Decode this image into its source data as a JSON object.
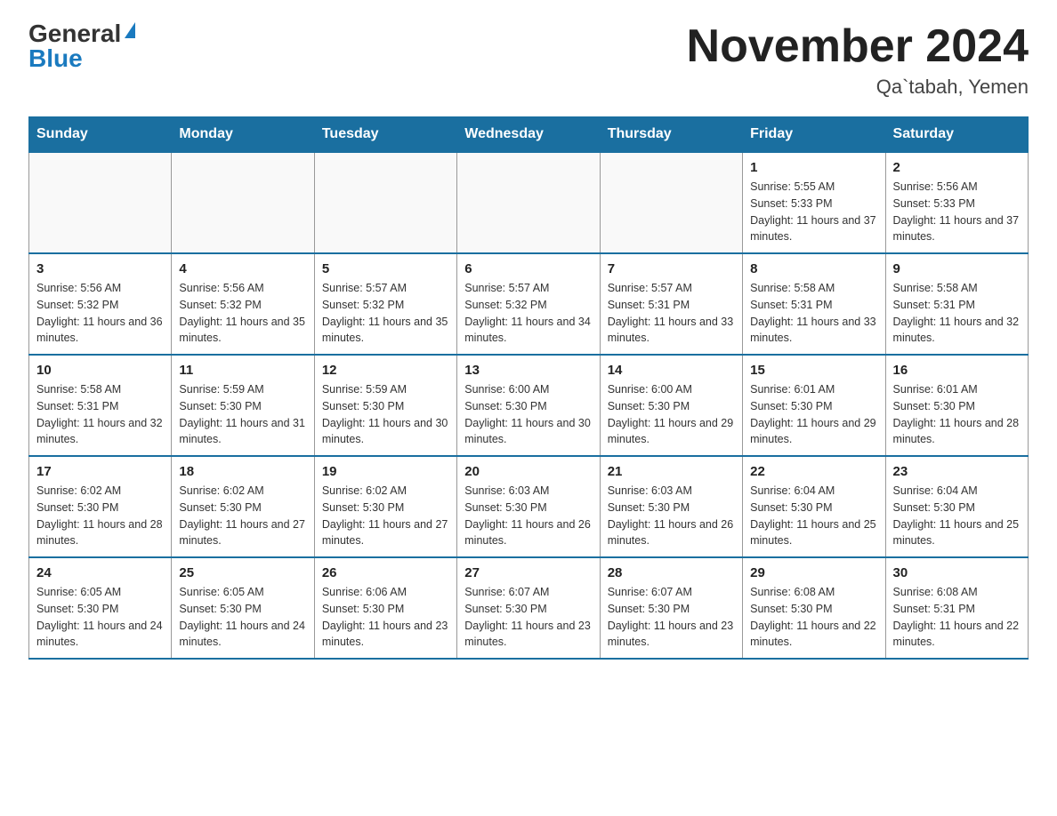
{
  "header": {
    "logo_general": "General",
    "logo_blue": "Blue",
    "title": "November 2024",
    "subtitle": "Qa`tabah, Yemen"
  },
  "calendar": {
    "days_of_week": [
      "Sunday",
      "Monday",
      "Tuesday",
      "Wednesday",
      "Thursday",
      "Friday",
      "Saturday"
    ],
    "weeks": [
      [
        {
          "day": "",
          "info": ""
        },
        {
          "day": "",
          "info": ""
        },
        {
          "day": "",
          "info": ""
        },
        {
          "day": "",
          "info": ""
        },
        {
          "day": "",
          "info": ""
        },
        {
          "day": "1",
          "info": "Sunrise: 5:55 AM\nSunset: 5:33 PM\nDaylight: 11 hours and 37 minutes."
        },
        {
          "day": "2",
          "info": "Sunrise: 5:56 AM\nSunset: 5:33 PM\nDaylight: 11 hours and 37 minutes."
        }
      ],
      [
        {
          "day": "3",
          "info": "Sunrise: 5:56 AM\nSunset: 5:32 PM\nDaylight: 11 hours and 36 minutes."
        },
        {
          "day": "4",
          "info": "Sunrise: 5:56 AM\nSunset: 5:32 PM\nDaylight: 11 hours and 35 minutes."
        },
        {
          "day": "5",
          "info": "Sunrise: 5:57 AM\nSunset: 5:32 PM\nDaylight: 11 hours and 35 minutes."
        },
        {
          "day": "6",
          "info": "Sunrise: 5:57 AM\nSunset: 5:32 PM\nDaylight: 11 hours and 34 minutes."
        },
        {
          "day": "7",
          "info": "Sunrise: 5:57 AM\nSunset: 5:31 PM\nDaylight: 11 hours and 33 minutes."
        },
        {
          "day": "8",
          "info": "Sunrise: 5:58 AM\nSunset: 5:31 PM\nDaylight: 11 hours and 33 minutes."
        },
        {
          "day": "9",
          "info": "Sunrise: 5:58 AM\nSunset: 5:31 PM\nDaylight: 11 hours and 32 minutes."
        }
      ],
      [
        {
          "day": "10",
          "info": "Sunrise: 5:58 AM\nSunset: 5:31 PM\nDaylight: 11 hours and 32 minutes."
        },
        {
          "day": "11",
          "info": "Sunrise: 5:59 AM\nSunset: 5:30 PM\nDaylight: 11 hours and 31 minutes."
        },
        {
          "day": "12",
          "info": "Sunrise: 5:59 AM\nSunset: 5:30 PM\nDaylight: 11 hours and 30 minutes."
        },
        {
          "day": "13",
          "info": "Sunrise: 6:00 AM\nSunset: 5:30 PM\nDaylight: 11 hours and 30 minutes."
        },
        {
          "day": "14",
          "info": "Sunrise: 6:00 AM\nSunset: 5:30 PM\nDaylight: 11 hours and 29 minutes."
        },
        {
          "day": "15",
          "info": "Sunrise: 6:01 AM\nSunset: 5:30 PM\nDaylight: 11 hours and 29 minutes."
        },
        {
          "day": "16",
          "info": "Sunrise: 6:01 AM\nSunset: 5:30 PM\nDaylight: 11 hours and 28 minutes."
        }
      ],
      [
        {
          "day": "17",
          "info": "Sunrise: 6:02 AM\nSunset: 5:30 PM\nDaylight: 11 hours and 28 minutes."
        },
        {
          "day": "18",
          "info": "Sunrise: 6:02 AM\nSunset: 5:30 PM\nDaylight: 11 hours and 27 minutes."
        },
        {
          "day": "19",
          "info": "Sunrise: 6:02 AM\nSunset: 5:30 PM\nDaylight: 11 hours and 27 minutes."
        },
        {
          "day": "20",
          "info": "Sunrise: 6:03 AM\nSunset: 5:30 PM\nDaylight: 11 hours and 26 minutes."
        },
        {
          "day": "21",
          "info": "Sunrise: 6:03 AM\nSunset: 5:30 PM\nDaylight: 11 hours and 26 minutes."
        },
        {
          "day": "22",
          "info": "Sunrise: 6:04 AM\nSunset: 5:30 PM\nDaylight: 11 hours and 25 minutes."
        },
        {
          "day": "23",
          "info": "Sunrise: 6:04 AM\nSunset: 5:30 PM\nDaylight: 11 hours and 25 minutes."
        }
      ],
      [
        {
          "day": "24",
          "info": "Sunrise: 6:05 AM\nSunset: 5:30 PM\nDaylight: 11 hours and 24 minutes."
        },
        {
          "day": "25",
          "info": "Sunrise: 6:05 AM\nSunset: 5:30 PM\nDaylight: 11 hours and 24 minutes."
        },
        {
          "day": "26",
          "info": "Sunrise: 6:06 AM\nSunset: 5:30 PM\nDaylight: 11 hours and 23 minutes."
        },
        {
          "day": "27",
          "info": "Sunrise: 6:07 AM\nSunset: 5:30 PM\nDaylight: 11 hours and 23 minutes."
        },
        {
          "day": "28",
          "info": "Sunrise: 6:07 AM\nSunset: 5:30 PM\nDaylight: 11 hours and 23 minutes."
        },
        {
          "day": "29",
          "info": "Sunrise: 6:08 AM\nSunset: 5:30 PM\nDaylight: 11 hours and 22 minutes."
        },
        {
          "day": "30",
          "info": "Sunrise: 6:08 AM\nSunset: 5:31 PM\nDaylight: 11 hours and 22 minutes."
        }
      ]
    ]
  }
}
